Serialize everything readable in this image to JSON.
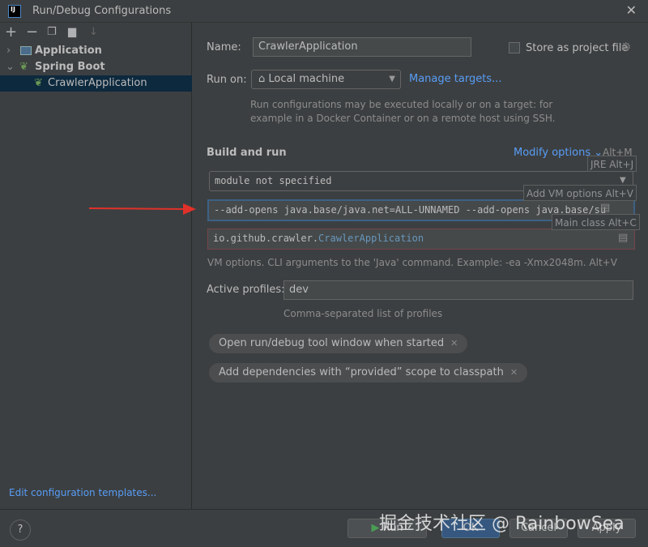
{
  "window": {
    "title": "Run/Debug Configurations",
    "logo": "IJ"
  },
  "toolbar": {
    "icons": [
      "plus-icon",
      "minus-icon",
      "copy-icon",
      "folder-add-icon",
      "sort-icon"
    ]
  },
  "tree": [
    {
      "label": "Application",
      "expanded": false
    },
    {
      "label": "Spring Boot",
      "expanded": true
    },
    {
      "label": "CrawlerApplication",
      "selected": true
    }
  ],
  "left_footer": {
    "templates_link": "Edit configuration templates..."
  },
  "form": {
    "name_label": "Name:",
    "name_value": "CrawlerApplication",
    "store_label": "Store as project file",
    "run_on_label": "Run on:",
    "run_on_value": "Local machine",
    "manage_targets": "Manage targets...",
    "run_on_hint_1": "Run configurations may be executed locally or on a target: for",
    "run_on_hint_2": "example in a Docker Container or on a remote host using SSH.",
    "build_run": "Build and run",
    "modify_options": "Modify options",
    "modify_shortcut": "Alt+M",
    "module_value": "module not specified",
    "vm_options": "--add-opens java.base/java.net=ALL-UNNAMED  --add-opens java.base/su",
    "main_class_pkg": "io.github.crawler.",
    "main_class_name": "CrawlerApplication",
    "vm_hint": "VM options. CLI arguments to the 'Java' command. Example: -ea -Xmx2048m. Alt+V",
    "profiles_label": "Active profiles:",
    "profiles_value": "dev",
    "profiles_hint": "Comma-separated list of profiles",
    "chips": [
      "Open run/debug tool window when started",
      "Add dependencies with “provided” scope to classpath"
    ]
  },
  "popups": {
    "jre": "JRE Alt+J",
    "vm": "Add VM options Alt+V",
    "main": "Main class Alt+C"
  },
  "buttons": {
    "run": "Run",
    "ok": "OK",
    "cancel": "Cancel",
    "apply": "Apply",
    "help": "?"
  },
  "watermark": "掘金技术社区 @ RainbowSea",
  "colors": {
    "accent": "#589df6",
    "ok": "#365880",
    "arrow": "#e0312a",
    "selection": "#0d293e"
  }
}
